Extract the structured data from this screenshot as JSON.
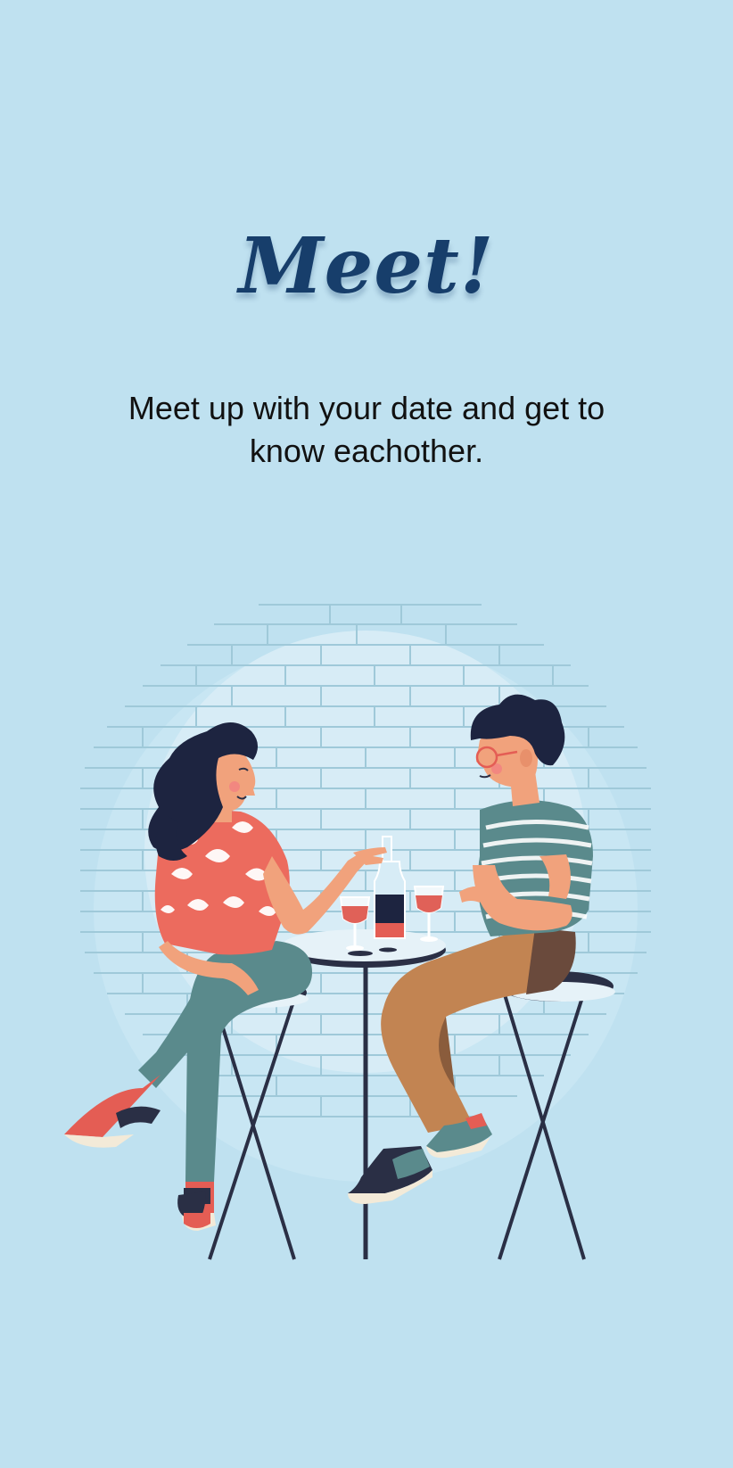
{
  "onboarding": {
    "title": "Meet!",
    "description": "Meet up with your date and get to know eachother."
  },
  "colors": {
    "background": "#bfe1f0",
    "title": "#173e6b",
    "text": "#111111",
    "accent_coral": "#ec6b5e",
    "accent_teal": "#5a8a8c"
  },
  "illustration": {
    "name": "couple-on-date-illustration"
  }
}
